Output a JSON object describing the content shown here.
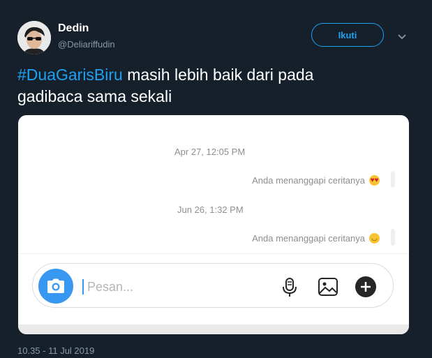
{
  "tweet": {
    "author_name": "Dedin",
    "author_handle": "@Deliariffudin",
    "follow_label": "Ikuti",
    "hashtag": "#DuaGarisBiru",
    "text_line1_rest": " masih lebih baik dari pada",
    "text_line2": "gadibaca sama sekali",
    "timestamp": "10.35 - 11 Jul 2019"
  },
  "dm": {
    "messages": [
      {
        "time": "Apr 27, 12:05 PM",
        "reply": "Anda menanggapi ceritanya",
        "emoji": "heart-eyes-emoji"
      },
      {
        "time": "Jun 26, 1:32 PM",
        "reply": "Anda menanggapi ceritanya",
        "emoji": "grinning-sweat-emoji"
      }
    ],
    "input_placeholder": "Pesan...",
    "icons": [
      "camera-icon",
      "microphone-icon",
      "image-icon",
      "plus-icon"
    ],
    "accent": "#3897f0"
  },
  "colors": {
    "background": "#15202b",
    "link": "#1da1f2",
    "muted": "#8899a6"
  }
}
